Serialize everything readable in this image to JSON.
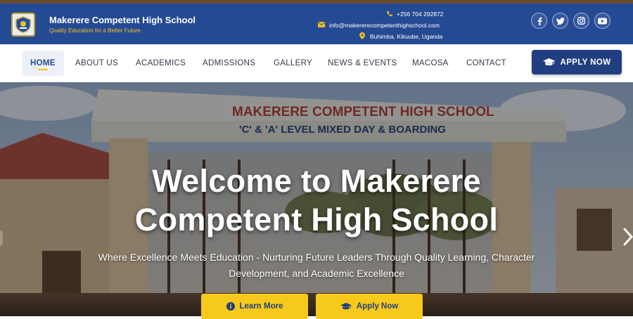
{
  "brand": {
    "name": "Makerere Competent High School",
    "tagline": "Quality Education for a Better Future"
  },
  "contact": {
    "phone": "+256 704 292872",
    "email": "info@makererecompetenthighschool.com",
    "location": "Buhimba, Kikuube, Uganda"
  },
  "socials": [
    "facebook",
    "twitter",
    "instagram",
    "youtube"
  ],
  "nav": {
    "items": [
      {
        "label": "HOME",
        "active": true
      },
      {
        "label": "ABOUT US"
      },
      {
        "label": "ACADEMICS"
      },
      {
        "label": "ADMISSIONS"
      },
      {
        "label": "GALLERY"
      },
      {
        "label": "NEWS & EVENTS"
      },
      {
        "label": "MACOSA"
      },
      {
        "label": "CONTACT"
      }
    ],
    "apply_label": "APPLY NOW"
  },
  "hero": {
    "title_line1": "Welcome to Makerere",
    "title_line2": "Competent High School",
    "subtitle": "Where Excellence Meets Education - Nurturing Future Leaders Through Quality Learning, Character Development, and Academic Excellence",
    "learn_more_label": "Learn More",
    "apply_label": "Apply Now",
    "gate_sign_line1": "MAKERERE COMPETENT HIGH SCHOOL",
    "gate_sign_line2": "'C' & 'A' LEVEL MIXED DAY & BOARDING"
  },
  "colors": {
    "primary": "#254a94",
    "accent": "#f6c91a",
    "nav_text": "#333a48"
  }
}
